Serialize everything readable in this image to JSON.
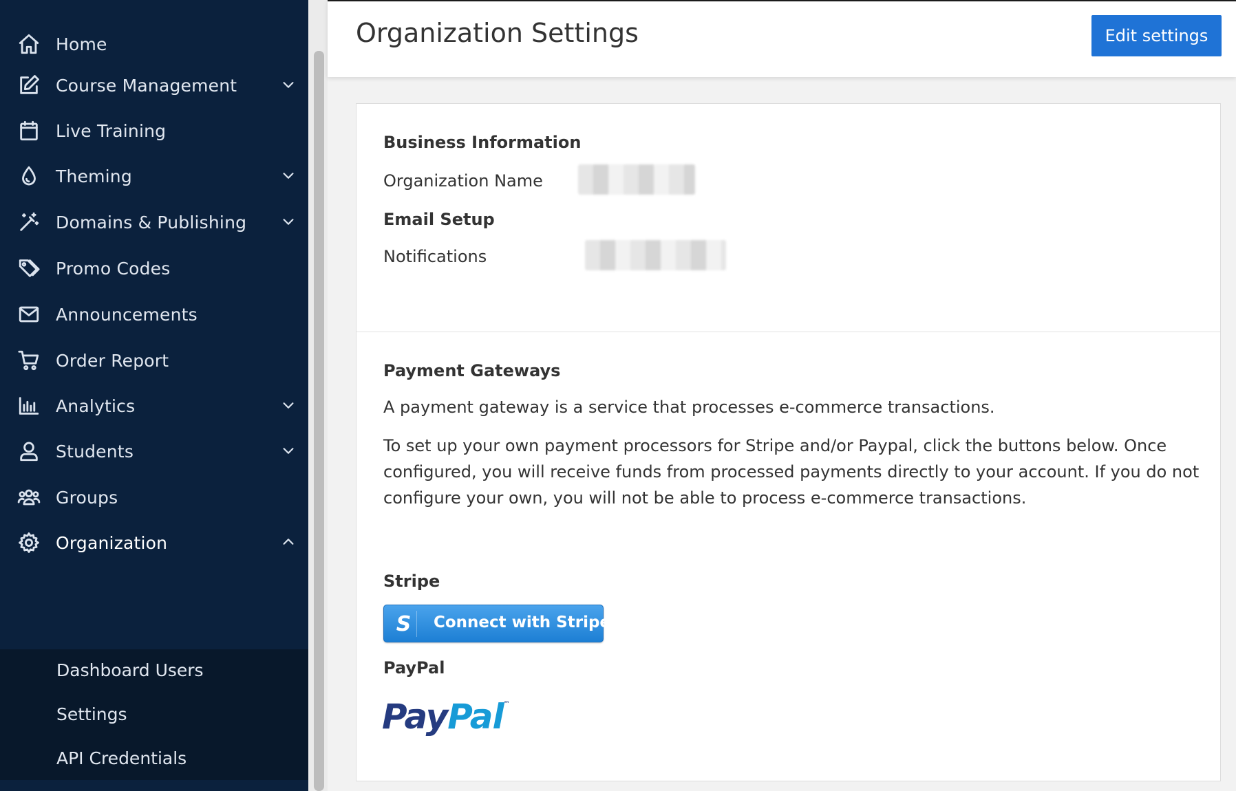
{
  "sidebar": {
    "items": [
      {
        "label": "Home",
        "icon": "home-icon"
      },
      {
        "label": "Course Management",
        "icon": "edit-icon",
        "expandable": true
      },
      {
        "label": "Live Training",
        "icon": "calendar-icon"
      },
      {
        "label": "Theming",
        "icon": "droplet-icon",
        "expandable": true
      },
      {
        "label": "Domains & Publishing",
        "icon": "magic-wand-icon",
        "expandable": true
      },
      {
        "label": "Promo Codes",
        "icon": "tags-icon"
      },
      {
        "label": "Announcements",
        "icon": "envelope-icon"
      },
      {
        "label": "Order Report",
        "icon": "cart-icon"
      },
      {
        "label": "Analytics",
        "icon": "bar-chart-icon",
        "expandable": true
      },
      {
        "label": "Students",
        "icon": "user-icon",
        "expandable": true
      },
      {
        "label": "Groups",
        "icon": "users-icon"
      },
      {
        "label": "Organization",
        "icon": "gear-icon",
        "expandable": true,
        "expanded": true
      }
    ],
    "sub_items": [
      {
        "label": "Dashboard Users"
      },
      {
        "label": "Settings"
      },
      {
        "label": "API Credentials"
      }
    ]
  },
  "header": {
    "title": "Organization Settings",
    "edit_button": "Edit settings"
  },
  "business": {
    "title": "Business Information",
    "org_name_label": "Organization Name",
    "email_title": "Email Setup",
    "notifications_label": "Notifications"
  },
  "payments": {
    "title": "Payment Gateways",
    "desc1": "A payment gateway is a service that processes e-commerce transactions.",
    "desc2": "To set up your own payment processors for Stripe and/or Paypal, click the buttons below. Once configured, you will receive funds from processed payments directly to your account. If you do not configure your own, you will not be able to process e-commerce transactions.",
    "stripe_title": "Stripe",
    "stripe_button": "Connect with Stripe",
    "stripe_letter": "S",
    "paypal_title": "PayPal",
    "paypal_logo_pay": "Pay",
    "paypal_logo_pal": "Pal",
    "paypal_logo_tm": "™"
  },
  "colors": {
    "sidebar_bg": "#0b213d",
    "subnav_bg": "#08182b",
    "primary_button": "#1f73d6",
    "stripe_blue": "#1d7fd4",
    "paypal_dark": "#253b80",
    "paypal_light": "#179bd7"
  }
}
